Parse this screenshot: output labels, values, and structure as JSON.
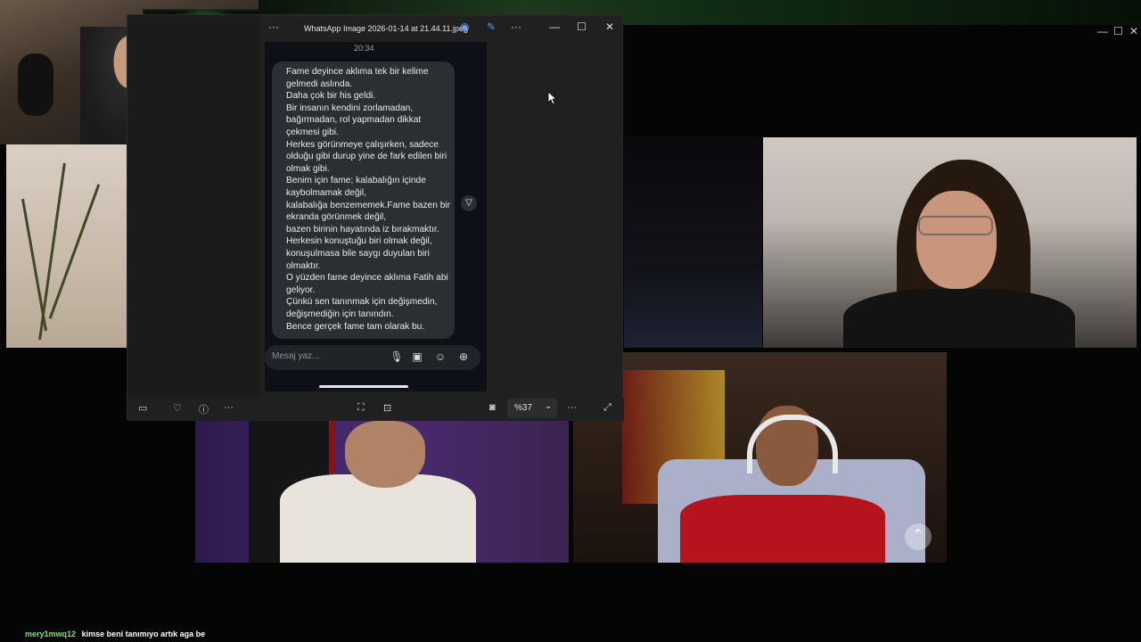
{
  "outer_window": {
    "minimize_icon": "—",
    "maximize_icon": "☐",
    "close_icon": "✕"
  },
  "viewer": {
    "more_label": "···",
    "title": "WhatsApp Image 2026-01-14 at 21.44.11.jpeg",
    "copilot_icon": "copilot-icon",
    "edit_icon": "edit-icon",
    "title_more": "···",
    "minimize": "—",
    "maximize": "☐",
    "close": "✕",
    "zoom_value": "%37",
    "zoom_chevron": "⌄"
  },
  "chat_image": {
    "timestamp": "20:34",
    "message_lines": [
      "Fame deyince aklıma tek bir kelime",
      "gelmedi aslında.",
      "Daha çok bir his geldi.",
      "Bir insanın kendini zorlamadan,",
      "bağırmadan, rol yapmadan dikkat",
      "çekmesi gibi.",
      "Herkes görünmeye çalışırken, sadece",
      "olduğu gibi durup yine de fark edilen biri",
      "olmak gibi.",
      "Benim için fame; kalabalığın içinde",
      "kaybolmamak değil,",
      "kalabalığa benzememek.Fame bazen bir",
      "ekranda görünmek değil,",
      "bazen birinin hayatında iz bırakmaktır.",
      "Herkesin konuştuğu biri olmak değil,",
      "konuşulmasa bile saygı duyulan biri",
      "olmaktır.",
      "O yüzden fame deyince aklıma Fatih abi",
      "geliyor.",
      "Çünkü sen tanınmak için değişmedin,",
      "değişmediğin için tanındın.",
      "Bence gerçek fame tam olarak bu."
    ],
    "input_placeholder": "Mesaj yaz..."
  },
  "stream_chat": {
    "username": "mery1mwq12",
    "message": "kimse beni tanımıyo artık aga be"
  }
}
